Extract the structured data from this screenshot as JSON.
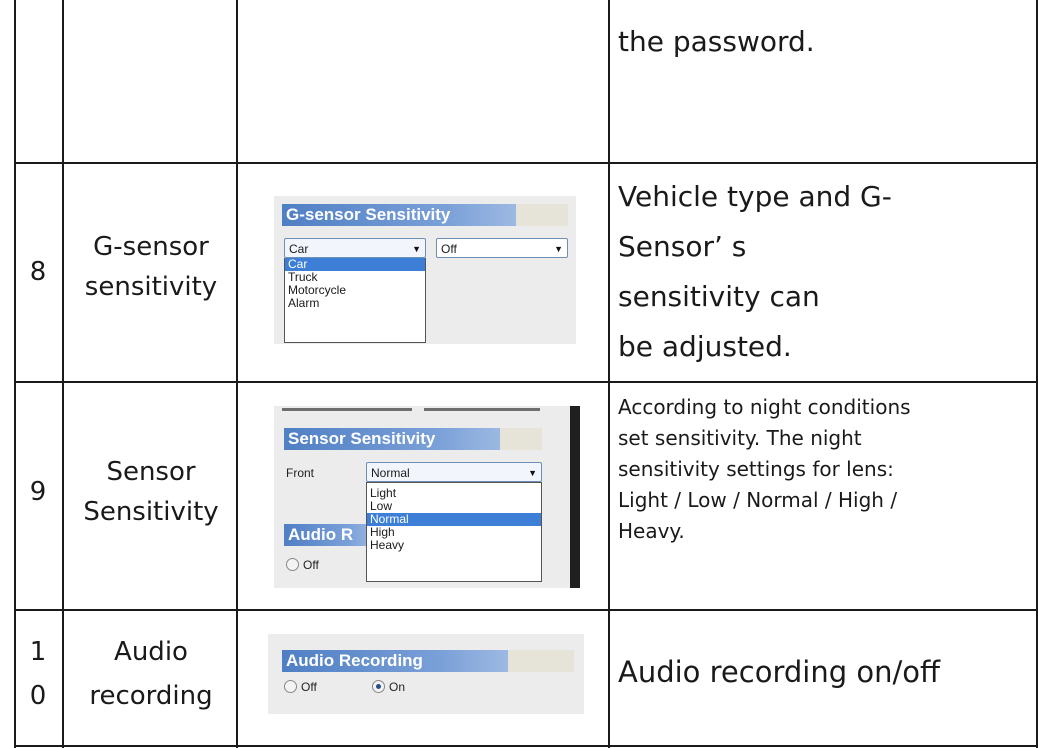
{
  "rows": [
    {
      "num": "",
      "feature": "",
      "description": "the password."
    },
    {
      "num": "8",
      "feature_line1": "G-sensor",
      "feature_line2": "sensitivity",
      "description_lines": [
        "Vehicle type and G-",
        "Sensor’ s",
        "sensitivity can",
        "be adjusted."
      ]
    },
    {
      "num": "9",
      "feature_line1": "Sensor",
      "feature_line2": "Sensitivity",
      "description_lines": [
        "According to night conditions",
        "set sensitivity. The night",
        "sensitivity settings for lens:",
        "Light / Low / Normal / High /",
        "Heavy."
      ]
    },
    {
      "num_line1": "1",
      "num_line2": "0",
      "feature_line1": "Audio",
      "feature_line2": "recording",
      "description": "Audio recording on/off"
    }
  ],
  "gsensor_panel": {
    "title": "G-sensor Sensitivity",
    "vehicle_value": "Car",
    "level_value": "Off",
    "vehicle_options": [
      "Car",
      "Truck",
      "Motorcycle",
      "Alarm"
    ],
    "selected_option": "Car"
  },
  "sensor_panel": {
    "title": "Sensor Sensitivity",
    "front_label": "Front",
    "front_value": "Normal",
    "options": [
      "Light",
      "Low",
      "Normal",
      "High",
      "Heavy"
    ],
    "selected_option": "Normal",
    "partial_header": "Audio R",
    "radio_off": "Off"
  },
  "audio_panel": {
    "title": "Audio Recording",
    "off_label": "Off",
    "on_label": "On",
    "selected": "On"
  }
}
